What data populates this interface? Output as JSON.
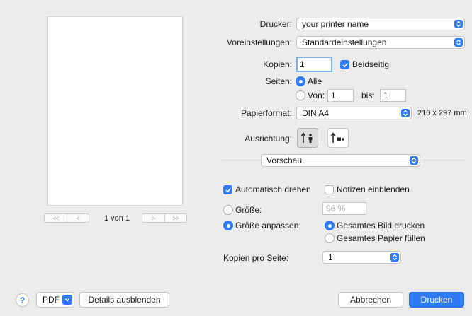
{
  "preview": {
    "nav_first": "<<",
    "nav_prev": "<",
    "nav_next": ">",
    "nav_last": ">>",
    "page_indicator": "1 von 1"
  },
  "printer": {
    "label": "Drucker:",
    "value": "your printer name"
  },
  "presets": {
    "label": "Voreinstellungen:",
    "value": "Standardeinstellungen"
  },
  "copies": {
    "label": "Kopien:",
    "value": "1",
    "duplex_label": "Beidseitig",
    "duplex_checked": true
  },
  "pages": {
    "label": "Seiten:",
    "all_label": "Alle",
    "all_selected": true,
    "from_label": "Von:",
    "from_value": "1",
    "to_label": "bis:",
    "to_value": "1"
  },
  "paper_size": {
    "label": "Papierformat:",
    "value": "DIN A4",
    "dimensions": "210 x 297 mm"
  },
  "orientation": {
    "label": "Ausrichtung:",
    "options": [
      "portrait-icon",
      "landscape-icon"
    ],
    "selected": "portrait-icon"
  },
  "section_popup": {
    "value": "Vorschau"
  },
  "options": {
    "auto_rotate_label": "Automatisch drehen",
    "auto_rotate_checked": true,
    "show_notes_label": "Notizen einblenden",
    "show_notes_checked": false,
    "size_label": "Größe:",
    "size_value": "96 %",
    "scale_to_fit_label": "Größe anpassen:",
    "scale_to_fit_selected": true,
    "print_entire_image_label": "Gesamtes Bild drucken",
    "print_entire_image_selected": true,
    "fill_entire_paper_label": "Gesamtes Papier füllen",
    "copies_per_page_label": "Kopien pro Seite:",
    "copies_per_page_value": "1"
  },
  "footer": {
    "help_label": "?",
    "pdf_label": "PDF",
    "hide_details_label": "Details ausblenden",
    "cancel_label": "Abbrechen",
    "print_label": "Drucken"
  },
  "colors": {
    "accent": "#2f7bf6",
    "background": "#ececec"
  }
}
